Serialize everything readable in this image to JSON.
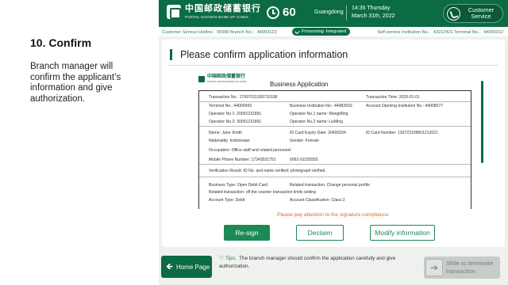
{
  "instruction": {
    "title": "10. Confirm",
    "description": "Branch manager will confirm the applicant’s information and give authorization."
  },
  "header": {
    "logo_cn": "中国邮政储蓄银行",
    "logo_en": "POSTAL SAVINGS BANK OF CHINA",
    "queue_number": "60",
    "region": "Guangdong",
    "time": "14:35 Thursday",
    "date": "March 31th, 2022",
    "customer_service_label": "Customer Service"
  },
  "infobar": {
    "hotline": "Customer Service Hotline：95580 Branch No.：44003123",
    "processing": "Processing: Integrated",
    "institution": "Self-service Institution No.：43212421  Terminal No.：44000312"
  },
  "card": {
    "title": "Please confirm application information"
  },
  "document": {
    "logo_cn": "中国邮政储蓄银行",
    "logo_en": "POSTAL SAVINGS BANK OF CHINA",
    "title": "Business Application",
    "transaction_no": "Transaction No.: 17997011303710158",
    "transaction_time": "Transaction Time:  2020-01-01",
    "terminal_no": "Terminal No.:  44000043",
    "business_institution": "Business Institution No.:  4498260Z",
    "account_opening_institution": "Account Opening Institution No.:  44008577",
    "operator_no1": "Operator No.1:  20091231891",
    "operator_name1": "Operator No.1 name:   WangMing",
    "operator_no2": "Operator No.2:  30091231891",
    "operator_name2": "Operator No.2 name:   LiuMing",
    "name": "Name:  Jane Smith",
    "id_expiry": "ID Card Expiry Date:  20400204",
    "id_number": "ID Card Number:  130723199601212021",
    "nationality": "Nationality:  Indonesian",
    "gender": "Gender:   Female",
    "occupation": "Occupation: Office staff and related personnel",
    "mobile": "Mobile Phone Number:  17343031751",
    "landline": "0062-02235555",
    "verification": "Verification Result: ID No. and name verified; photograph verified.",
    "business_type": "Business Type: Open Debit Card",
    "related_transaction": "Related transaction:  Change personal profile",
    "related_transaction2": "Related transaction:  off the counter transaction limits setting",
    "account_type": "Account Type:   Debit",
    "account_classification": "Account Classification:   Class 2"
  },
  "notice": "Please pay attention to the signature compliance.",
  "buttons": {
    "resign": "Re-sign",
    "declaim": "Declaim",
    "modify": "Modify information"
  },
  "footer": {
    "home": "Home Page",
    "tips_label": "Tips:",
    "tips_text": "The branch manager should confirm the application carefully and give authorization.",
    "slide": "Slide to terminate transaction"
  },
  "colors": {
    "brand_green": "#0b6b43",
    "accent_green": "#1b8a55",
    "notice_orange": "#e06a2b"
  }
}
